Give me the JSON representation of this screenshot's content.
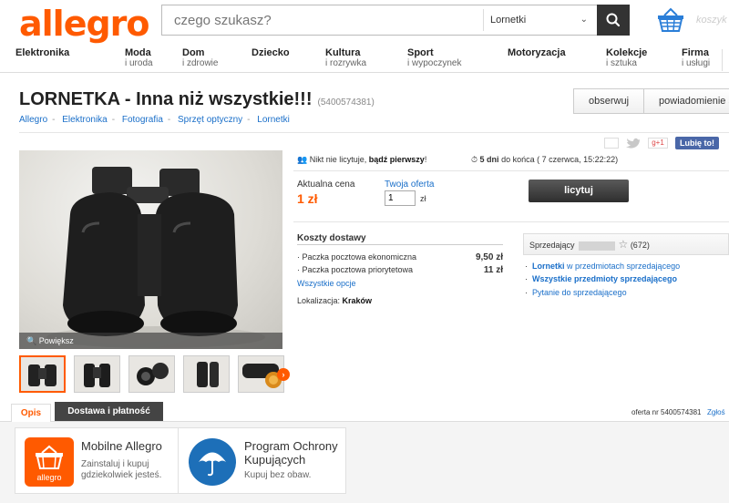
{
  "header": {
    "logo": "allegro",
    "search_placeholder": "czego szukasz?",
    "search_category": "Lornetki",
    "cart_label": "koszyk"
  },
  "nav": [
    {
      "title": "Elektronika",
      "sub": ""
    },
    {
      "title": "Moda",
      "sub": "i uroda"
    },
    {
      "title": "Dom",
      "sub": "i zdrowie"
    },
    {
      "title": "Dziecko",
      "sub": ""
    },
    {
      "title": "Kultura",
      "sub": "i rozrywka"
    },
    {
      "title": "Sport",
      "sub": "i wypoczynek"
    },
    {
      "title": "Motoryzacja",
      "sub": ""
    },
    {
      "title": "Kolekcje",
      "sub": "i sztuka"
    },
    {
      "title": "Firma",
      "sub": "i usługi"
    }
  ],
  "offer": {
    "title": "LORNETKA - Inna niż wszystkie!!!",
    "id_paren": "(5400574381)",
    "actions": {
      "watch": "obserwuj",
      "sms": "powiadomienie sms"
    },
    "breadcrumb": [
      "Allegro",
      "Elektronika",
      "Fotografia",
      "Sprzęt optyczny",
      "Lornetki"
    ],
    "social_like": "Lubię to!",
    "social_gplus": "g+1",
    "zoom_label": "Powiększ",
    "bids_prefix": "Nikt nie licytuje,",
    "bids_bold": "bądź pierwszy",
    "bids_suffix": "!",
    "time_bold": "5 dni",
    "time_rest": "do końca ( 7 czerwca, 15:22:22)",
    "price_label": "Aktualna cena",
    "price": "1 zł",
    "your_offer_label": "Twoja oferta",
    "your_offer_value": "1",
    "currency": "zł",
    "bid_button": "licytuj"
  },
  "shipping": {
    "title": "Koszty dostawy",
    "rows": [
      {
        "name": "Paczka pocztowa ekonomiczna",
        "price": "9,50 zł"
      },
      {
        "name": "Paczka pocztowa priorytetowa",
        "price": "11 zł"
      }
    ],
    "all_options": "Wszystkie opcje",
    "location_label": "Lokalizacja:",
    "location_value": "Kraków"
  },
  "seller": {
    "label": "Sprzedający",
    "rating": "(672)",
    "links": [
      {
        "bold": "Lornetki",
        "rest": " w przedmiotach sprzedającego"
      },
      {
        "bold": "Wszystkie przedmioty sprzedającego",
        "rest": ""
      },
      {
        "bold": "",
        "rest": "Pytanie do sprzedającego"
      }
    ]
  },
  "tabs": {
    "description": "Opis",
    "delivery": "Dostawa i płatność",
    "offer_nr": "oferta nr 5400574381",
    "report": "Zgłoś"
  },
  "promos": [
    {
      "title": "Mobilne Allegro",
      "lines": [
        "Zainstaluj i kupuj",
        "gdziekolwiek jesteś."
      ],
      "icon_text": "allegro"
    },
    {
      "title": "Program Ochrony Kupujących",
      "lines": [
        "Kupuj bez obaw."
      ]
    }
  ],
  "colors": {
    "brand": "#ff5a00",
    "link": "#1a6fc9",
    "button_dark": "#333333",
    "facebook": "#4a67a8"
  }
}
